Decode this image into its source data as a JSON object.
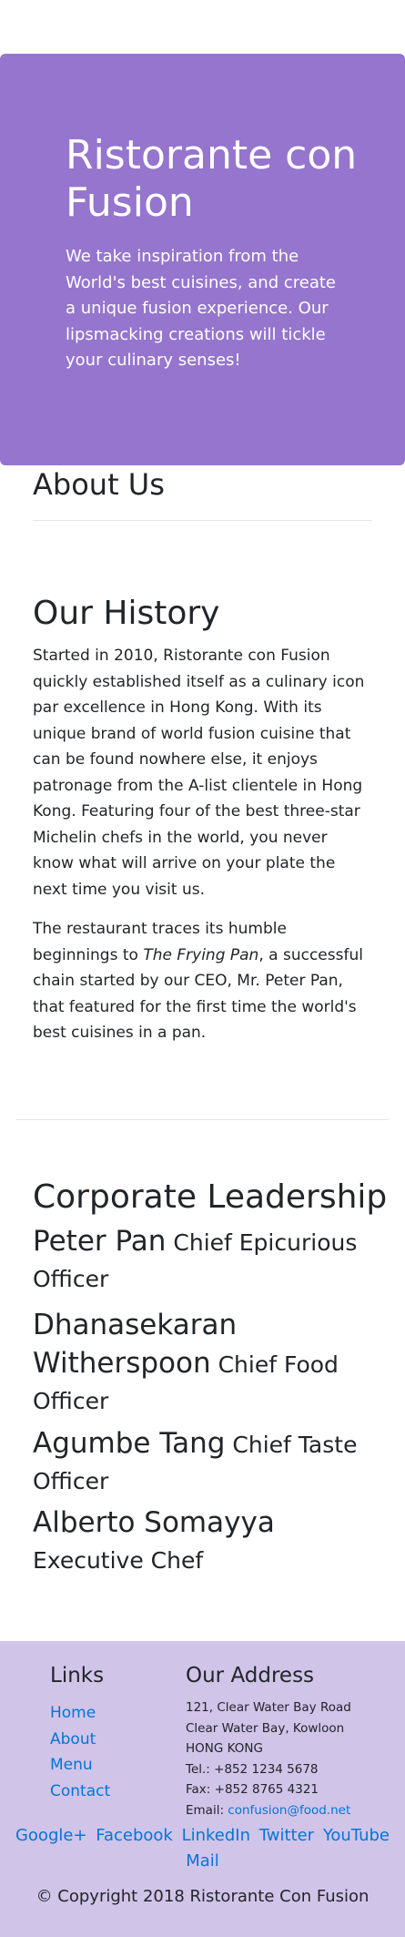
{
  "jumbotron": {
    "title": "Ristorante con Fusion",
    "description": "We take inspiration from the World's best cuisines, and create a unique fusion experience. Our lipsmacking creations will tickle your culinary senses!"
  },
  "about": {
    "heading": "About Us"
  },
  "history": {
    "heading": "Our History",
    "p1": "Started in 2010, Ristorante con Fusion quickly established itself as a culinary icon par excellence in Hong Kong. With its unique brand of world fusion cuisine that can be found nowhere else, it enjoys patronage from the A-list clientele in Hong Kong. Featuring four of the best three-star Michelin chefs in the world, you never know what will arrive on your plate the next time you visit us.",
    "p2_before": "The restaurant traces its humble beginnings to ",
    "p2_italic": "The Frying Pan",
    "p2_after": ", a successful chain started by our CEO, Mr. Peter Pan, that featured for the first time the world's best cuisines in a pan."
  },
  "leadership": {
    "heading": "Corporate Leadership",
    "leaders": [
      {
        "name": "Peter Pan",
        "title": "Chief Epicurious Officer"
      },
      {
        "name": "Dhanasekaran Witherspoon",
        "title": "Chief Food Officer"
      },
      {
        "name": "Agumbe Tang",
        "title": "Chief Taste Officer"
      },
      {
        "name": "Alberto Somayya",
        "title": "Executive Chef"
      }
    ]
  },
  "footer": {
    "links_heading": "Links",
    "links": [
      "Home",
      "About",
      "Menu",
      "Contact"
    ],
    "address_heading": "Our Address",
    "address_lines": [
      "121, Clear Water Bay Road",
      "Clear Water Bay, Kowloon",
      "HONG KONG",
      "Tel.: +852 1234 5678",
      "Fax: +852 8765 4321"
    ],
    "email_label": "Email: ",
    "email": "confusion@food.net",
    "social": [
      "Google+",
      "Facebook",
      "LinkedIn",
      "Twitter",
      "YouTube",
      "Mail"
    ],
    "copyright": "© Copyright 2018 Ristorante Con Fusion"
  },
  "colors": {
    "jumbotron_bg": "#9575cd",
    "footer_bg": "#d1c4e9",
    "link": "#0275d8"
  }
}
